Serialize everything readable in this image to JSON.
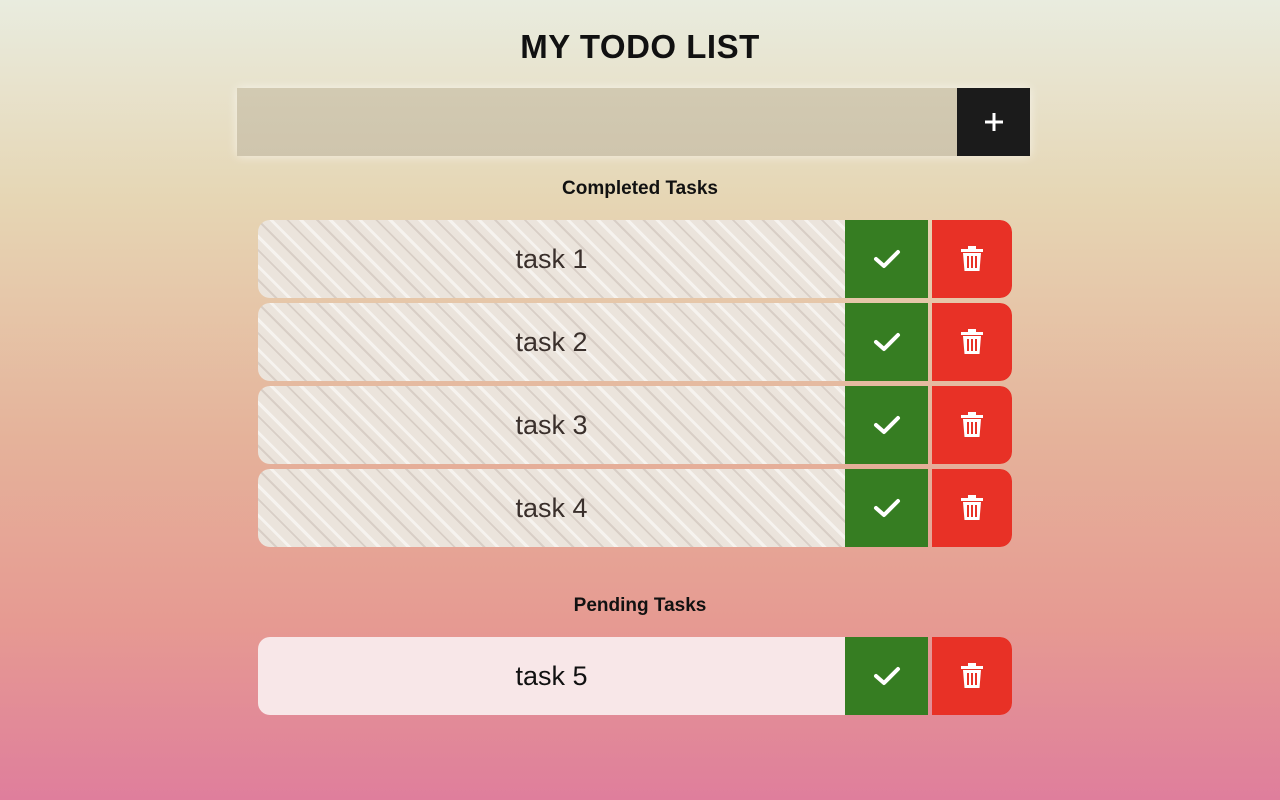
{
  "app": {
    "title": "MY TODO LIST"
  },
  "input": {
    "value": "",
    "placeholder": "",
    "add_button_label": "+"
  },
  "completed": {
    "heading": "Completed Tasks",
    "tasks": [
      {
        "label": "task 1"
      },
      {
        "label": "task 2"
      },
      {
        "label": "task 3"
      },
      {
        "label": "task 4"
      }
    ]
  },
  "pending": {
    "heading": "Pending Tasks",
    "tasks": [
      {
        "label": "task 5"
      }
    ]
  },
  "icons": {
    "check": "check-icon",
    "delete": "trash-icon",
    "add": "plus-icon"
  },
  "colors": {
    "check_button": "#367d22",
    "delete_button": "#e83126",
    "add_button": "#1b1b1b",
    "pending_task_bg": "#f8e7e8"
  }
}
